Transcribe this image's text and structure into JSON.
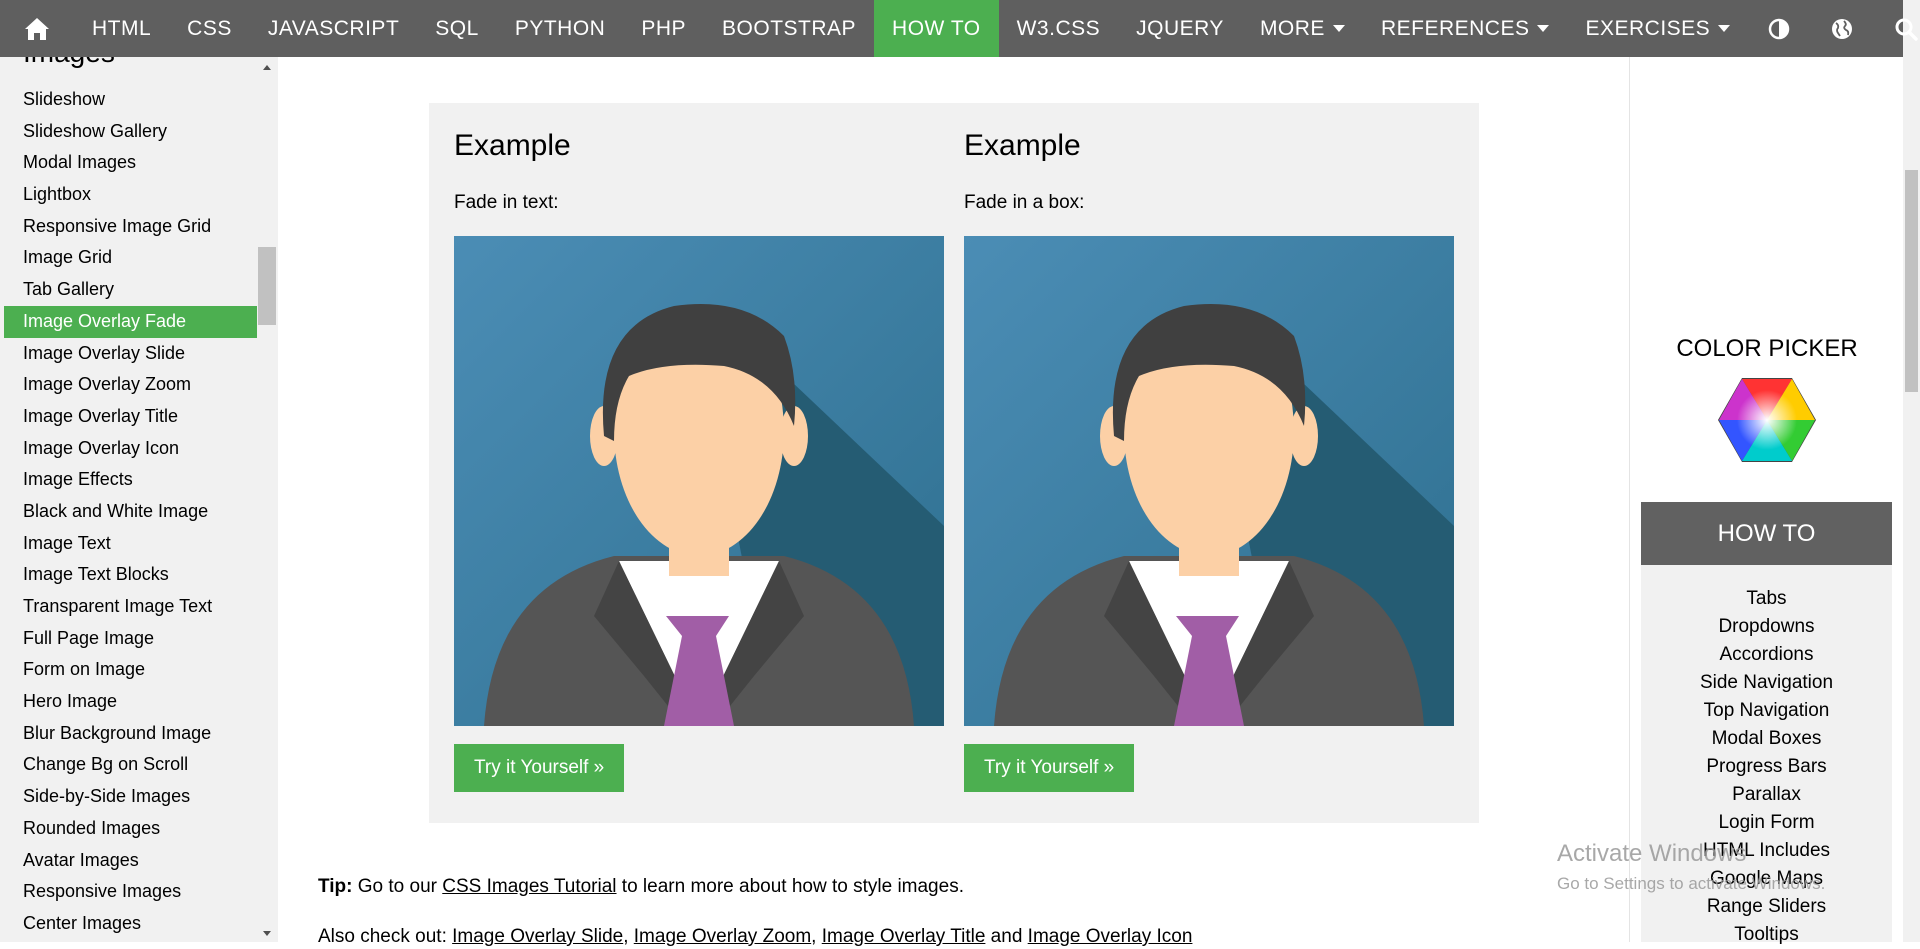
{
  "nav": {
    "items": [
      {
        "label": "HTML"
      },
      {
        "label": "CSS"
      },
      {
        "label": "JAVASCRIPT"
      },
      {
        "label": "SQL"
      },
      {
        "label": "PYTHON"
      },
      {
        "label": "PHP"
      },
      {
        "label": "BOOTSTRAP"
      },
      {
        "label": "HOW TO",
        "active": true
      },
      {
        "label": "W3.CSS"
      },
      {
        "label": "JQUERY"
      },
      {
        "label": "MORE"
      }
    ],
    "right_items": [
      {
        "label": "REFERENCES"
      },
      {
        "label": "EXERCISES"
      }
    ],
    "icons": [
      "home-icon",
      "contrast-icon",
      "globe-icon",
      "search-icon"
    ],
    "active_color": "#4CAF50",
    "bg_color": "#5f5f5f"
  },
  "sidebar": {
    "heading": "Images",
    "items": [
      "Slideshow",
      "Slideshow Gallery",
      "Modal Images",
      "Lightbox",
      "Responsive Image Grid",
      "Image Grid",
      "Tab Gallery",
      "Image Overlay Fade",
      "Image Overlay Slide",
      "Image Overlay Zoom",
      "Image Overlay Title",
      "Image Overlay Icon",
      "Image Effects",
      "Black and White Image",
      "Image Text",
      "Image Text Blocks",
      "Transparent Image Text",
      "Full Page Image",
      "Form on Image",
      "Hero Image",
      "Blur Background Image",
      "Change Bg on Scroll",
      "Side-by-Side Images",
      "Rounded Images",
      "Avatar Images",
      "Responsive Images",
      "Center Images"
    ],
    "active_item": "Image Overlay Fade"
  },
  "examples": [
    {
      "title": "Example",
      "caption": "Fade in text:",
      "button": "Try it Yourself »"
    },
    {
      "title": "Example",
      "caption": "Fade in a box:",
      "button": "Try it Yourself »"
    }
  ],
  "tip": {
    "label": "Tip:",
    "text_before": " Go to our ",
    "link": "CSS Images Tutorial",
    "text_after": " to learn more about how to style images."
  },
  "also": {
    "text": "Also check out: ",
    "links": [
      "Image Overlay Slide",
      "Image Overlay Zoom",
      "Image Overlay Title",
      "Image Overlay Icon"
    ],
    "sep": ", ",
    "last_sep": " and "
  },
  "right": {
    "color_picker": "COLOR PICKER",
    "howto_title": "HOW TO",
    "howto_links": [
      "Tabs",
      "Dropdowns",
      "Accordions",
      "Side Navigation",
      "Top Navigation",
      "Modal Boxes",
      "Progress Bars",
      "Parallax",
      "Login Form",
      "HTML Includes",
      "Google Maps",
      "Range Sliders",
      "Tooltips"
    ]
  },
  "watermark": {
    "line1": "Activate Windows",
    "line2": "Go to Settings to activate Windows."
  }
}
